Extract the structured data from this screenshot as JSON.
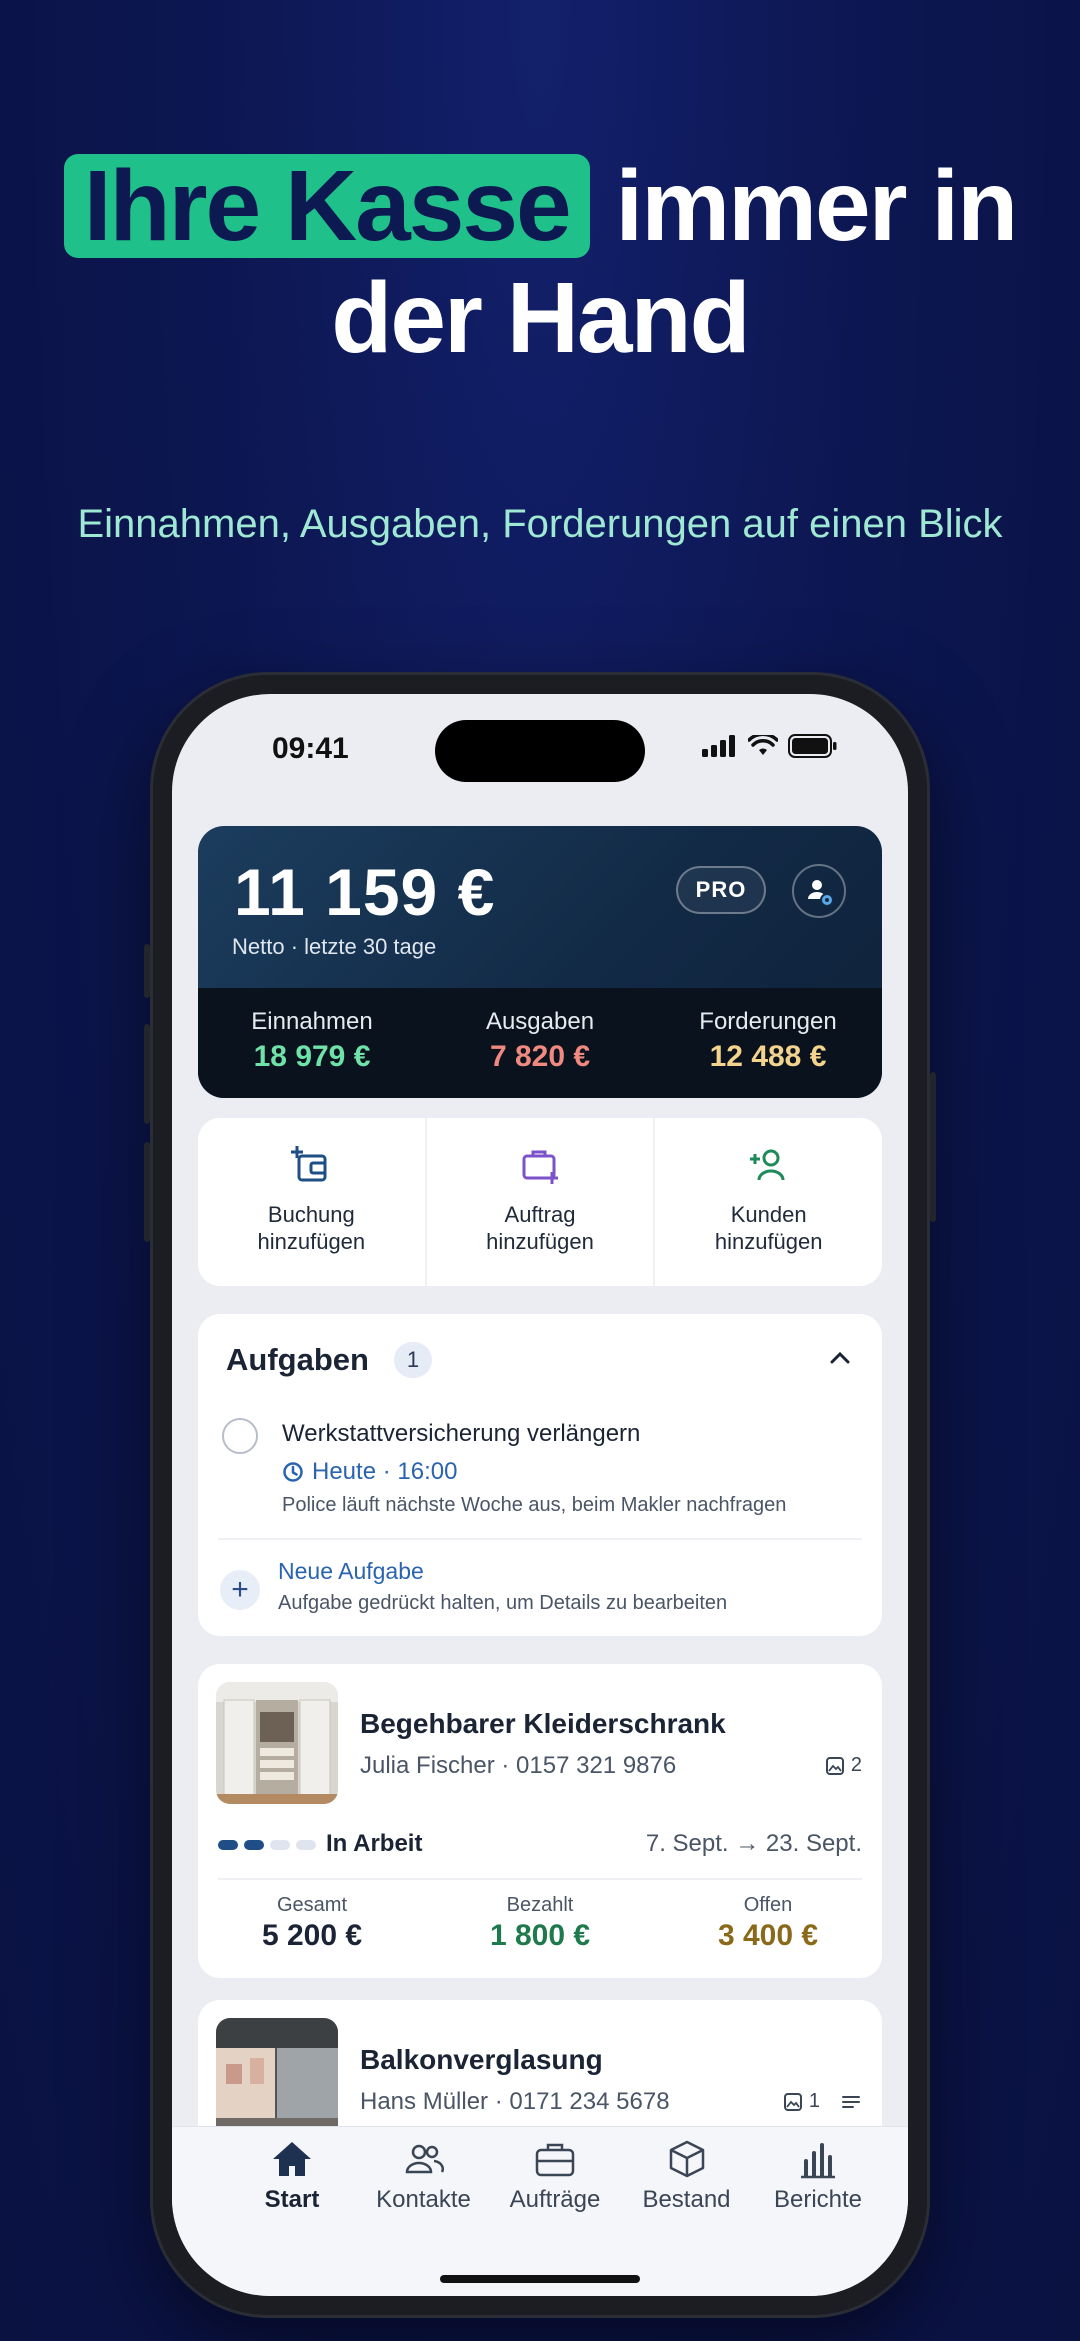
{
  "promo": {
    "headline_highlight": "Ihre Kasse",
    "headline_rest_line1": "immer in",
    "headline_line2": "der Hand",
    "subline": "Einnahmen, Ausgaben, Forderungen auf einen Blick"
  },
  "status_bar": {
    "time": "09:41"
  },
  "balance": {
    "amount": "11 159 €",
    "subtitle": "Netto · letzte 30 tage",
    "badge": "PRO",
    "stats": [
      {
        "label": "Einnahmen",
        "value": "18 979 €",
        "color": "#6ee2a8"
      },
      {
        "label": "Ausgaben",
        "value": "7 820 €",
        "color": "#f08a80"
      },
      {
        "label": "Forderungen",
        "value": "12 488 €",
        "color": "#f3d38d"
      }
    ]
  },
  "quick_actions": [
    {
      "line1": "Buchung",
      "line2": "hinzufügen",
      "icon": "wallet-plus-icon",
      "color": "#1f4e86"
    },
    {
      "line1": "Auftrag",
      "line2": "hinzufügen",
      "icon": "briefcase-plus-icon",
      "color": "#7b52c9"
    },
    {
      "line1": "Kunden",
      "line2": "hinzufügen",
      "icon": "user-plus-icon",
      "color": "#1e8a5a"
    }
  ],
  "tasks": {
    "title": "Aufgaben",
    "count": "1",
    "items": [
      {
        "title": "Werkstattversicherung verlängern",
        "when": "Heute · 16:00",
        "note": "Police läuft nächste Woche aus, beim Makler nachfragen"
      }
    ],
    "new_task_label": "Neue Aufgabe",
    "new_task_hint": "Aufgabe gedrückt halten, um Details zu bearbeiten"
  },
  "orders": [
    {
      "title": "Begehbarer Kleiderschrank",
      "customer": "Julia Fischer",
      "phone": "0157 321 9876",
      "image_count": "2",
      "status": "In Arbeit",
      "progress_steps_done": 2,
      "progress_steps_total": 4,
      "dates": "7. Sept. → 23. Sept.",
      "totals": [
        {
          "label": "Gesamt",
          "value": "5 200 €",
          "color": "#1a2434"
        },
        {
          "label": "Bezahlt",
          "value": "1 800 €",
          "color": "#1e7a4c"
        },
        {
          "label": "Offen",
          "value": "3 400 €",
          "color": "#8a6a1a"
        }
      ]
    },
    {
      "title": "Balkonverglasung",
      "customer": "Hans Müller",
      "phone": "0171 234 5678",
      "image_count": "1"
    }
  ],
  "tab_bar": [
    {
      "label": "Start",
      "icon": "home-icon",
      "active": true
    },
    {
      "label": "Kontakte",
      "icon": "contacts-icon",
      "active": false
    },
    {
      "label": "Aufträge",
      "icon": "briefcase-icon",
      "active": false
    },
    {
      "label": "Bestand",
      "icon": "box-icon",
      "active": false
    },
    {
      "label": "Berichte",
      "icon": "bar-chart-icon",
      "active": false
    }
  ]
}
